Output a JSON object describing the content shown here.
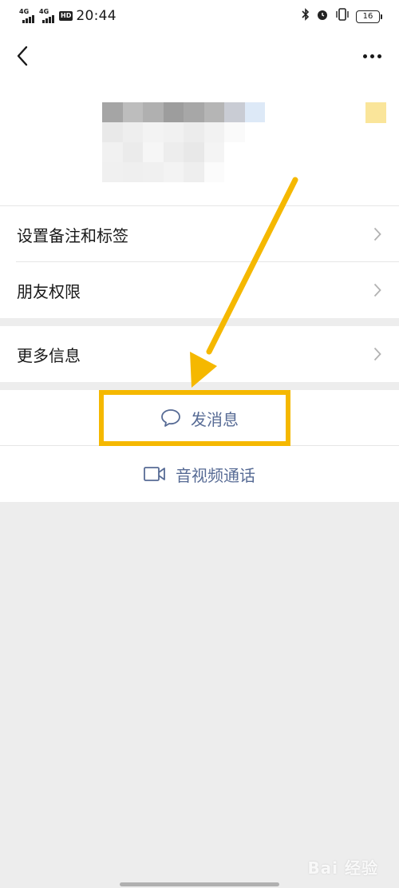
{
  "status_bar": {
    "signal1_label": "4G",
    "signal2_label": "4G",
    "hd_label": "HD",
    "time": "20:44",
    "battery": "16"
  },
  "nav": {
    "back_icon": "chevron-left-icon",
    "more_icon": "more-dots-icon"
  },
  "menu": {
    "items": [
      {
        "label": "设置备注和标签"
      },
      {
        "label": "朋友权限"
      },
      {
        "label": "更多信息"
      }
    ]
  },
  "actions": {
    "send_message": "发消息",
    "av_call": "音视频通话",
    "send_message_icon": "chat-bubble-icon",
    "av_call_icon": "video-camera-icon"
  },
  "annotation": {
    "color": "#f5b800"
  },
  "colors": {
    "link": "#576b95",
    "background": "#ededed"
  },
  "watermark": "Bai 经验"
}
